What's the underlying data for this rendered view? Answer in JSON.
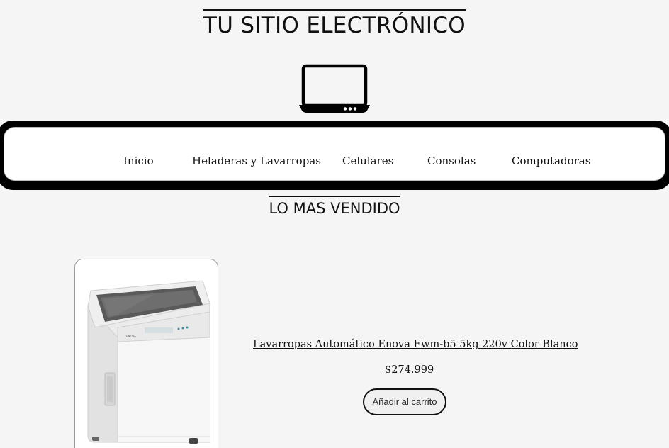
{
  "header": {
    "site_title": "TU SITIO ELECTRÓNICO",
    "logo_icon": "laptop-icon"
  },
  "nav": {
    "items": [
      {
        "label": "Inicio"
      },
      {
        "label": "Heladeras y Lavarropas"
      },
      {
        "label": "Celulares"
      },
      {
        "label": "Consolas"
      },
      {
        "label": "Computadoras"
      }
    ]
  },
  "section": {
    "title": "LO MAS VENDIDO"
  },
  "product": {
    "image_icon": "washing-machine-image",
    "title": "Lavarropas Automático Enova Ewm-b5 5kg 220v Color Blanco",
    "price": "$274.999",
    "cart_label": "Añadir al carrito"
  }
}
